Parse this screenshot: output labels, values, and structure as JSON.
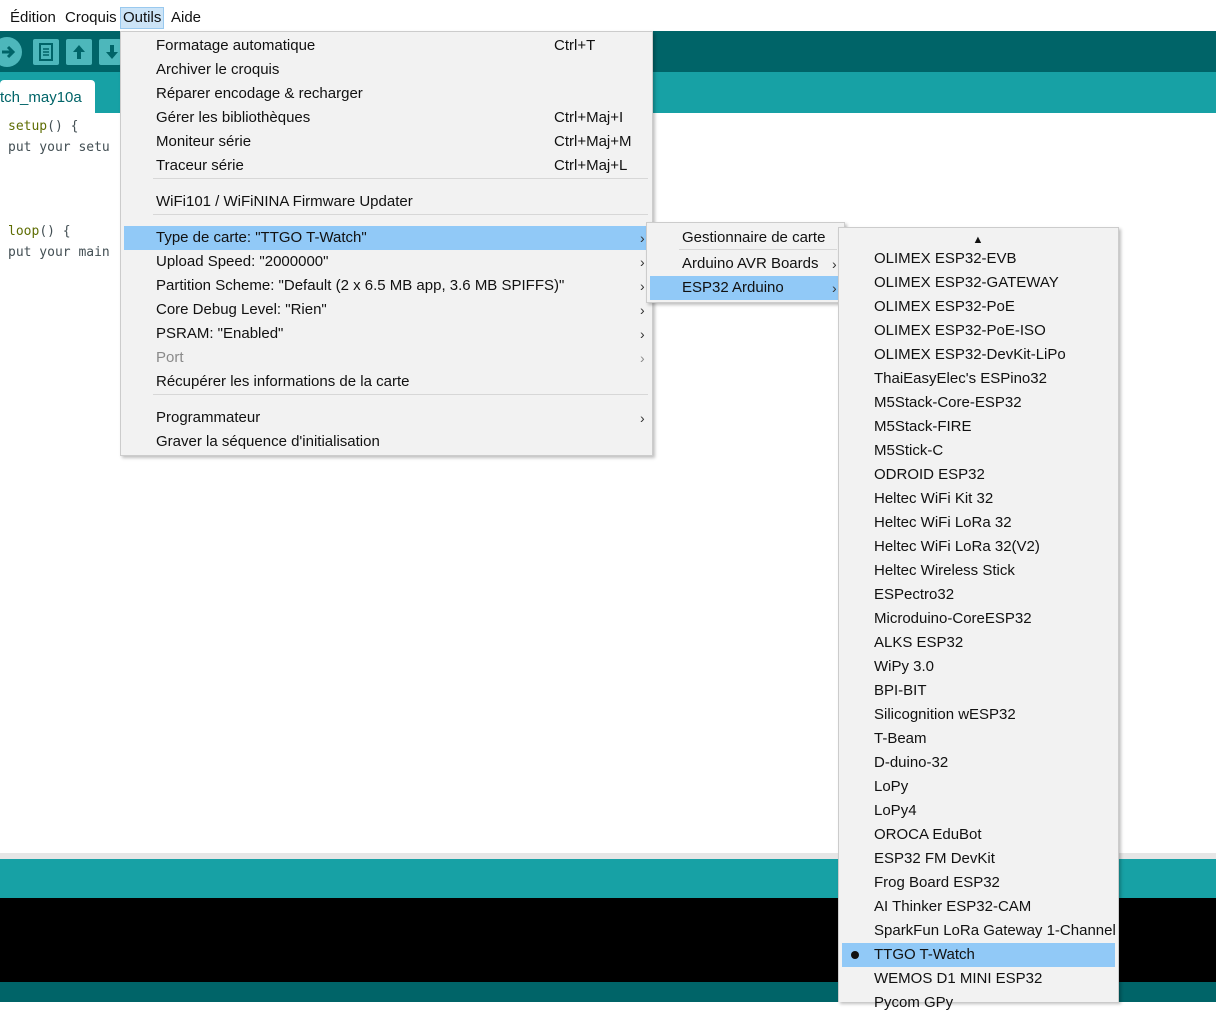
{
  "menubar": {
    "items": [
      "Édition",
      "Croquis",
      "Outils",
      "Aide"
    ],
    "active": "Outils"
  },
  "toolbar": {
    "buttons": [
      "verify-icon",
      "new-sketch-icon",
      "open-icon",
      "save-icon"
    ],
    "colors": {
      "dark": "#006468",
      "teal": "#17a1a5",
      "button": "#4db7bb"
    }
  },
  "tab": {
    "label": "tch_may10a"
  },
  "editor": {
    "lines": [
      {
        "kw": "setup",
        "rest": "() {"
      },
      {
        "kw": "",
        "rest": "put your setu"
      },
      {
        "kw": "loop",
        "rest": "() {"
      },
      {
        "kw": "",
        "rest": "put your main"
      }
    ]
  },
  "tools_menu": {
    "items": [
      {
        "label": "Formatage automatique",
        "shortcut": "Ctrl+T"
      },
      {
        "label": "Archiver le croquis",
        "shortcut": ""
      },
      {
        "label": "Réparer encodage & recharger",
        "shortcut": ""
      },
      {
        "label": "Gérer les bibliothèques",
        "shortcut": "Ctrl+Maj+I"
      },
      {
        "label": "Moniteur série",
        "shortcut": "Ctrl+Maj+M"
      },
      {
        "label": "Traceur série",
        "shortcut": "Ctrl+Maj+L"
      },
      {
        "label": "WiFi101 / WiFiNINA Firmware Updater",
        "shortcut": ""
      },
      {
        "label": "Type de carte: \"TTGO T-Watch\"",
        "shortcut": "",
        "submenu": true,
        "highlighted": true
      },
      {
        "label": "Upload Speed: \"2000000\"",
        "shortcut": "",
        "submenu": true
      },
      {
        "label": "Partition Scheme: \"Default (2 x 6.5 MB app, 3.6 MB SPIFFS)\"",
        "shortcut": "",
        "submenu": true
      },
      {
        "label": "Core Debug Level: \"Rien\"",
        "shortcut": "",
        "submenu": true
      },
      {
        "label": "PSRAM: \"Enabled\"",
        "shortcut": "",
        "submenu": true
      },
      {
        "label": "Port",
        "shortcut": "",
        "submenu": true,
        "disabled": true
      },
      {
        "label": "Récupérer les informations de la carte",
        "shortcut": ""
      },
      {
        "label": "Programmateur",
        "shortcut": "",
        "submenu": true
      },
      {
        "label": "Graver la séquence d'initialisation",
        "shortcut": ""
      }
    ],
    "arrow": "›"
  },
  "board_menu": {
    "items": [
      {
        "label": "Gestionnaire de carte"
      },
      {
        "label": "Arduino AVR Boards",
        "submenu": true
      },
      {
        "label": "ESP32 Arduino",
        "submenu": true,
        "highlighted": true
      }
    ]
  },
  "esp32_menu": {
    "scroll_up": "▲",
    "items": [
      "OLIMEX ESP32-EVB",
      "OLIMEX ESP32-GATEWAY",
      "OLIMEX ESP32-PoE",
      "OLIMEX ESP32-PoE-ISO",
      "OLIMEX ESP32-DevKit-LiPo",
      "ThaiEasyElec's ESPino32",
      "M5Stack-Core-ESP32",
      "M5Stack-FIRE",
      "M5Stick-C",
      "ODROID ESP32",
      "Heltec WiFi Kit 32",
      "Heltec WiFi LoRa 32",
      "Heltec WiFi LoRa 32(V2)",
      "Heltec Wireless Stick",
      "ESPectro32",
      "Microduino-CoreESP32",
      "ALKS ESP32",
      "WiPy 3.0",
      "BPI-BIT",
      "Silicognition wESP32",
      "T-Beam",
      "D-duino-32",
      "LoPy",
      "LoPy4",
      "OROCA EduBot",
      "ESP32 FM DevKit",
      "Frog Board ESP32",
      "AI Thinker ESP32-CAM",
      "SparkFun LoRa Gateway 1-Channel",
      "TTGO T-Watch",
      "WEMOS D1 MINI ESP32",
      "Pycom GPy"
    ],
    "selected": "TTGO T-Watch",
    "highlight_color": "#91c9f7"
  }
}
